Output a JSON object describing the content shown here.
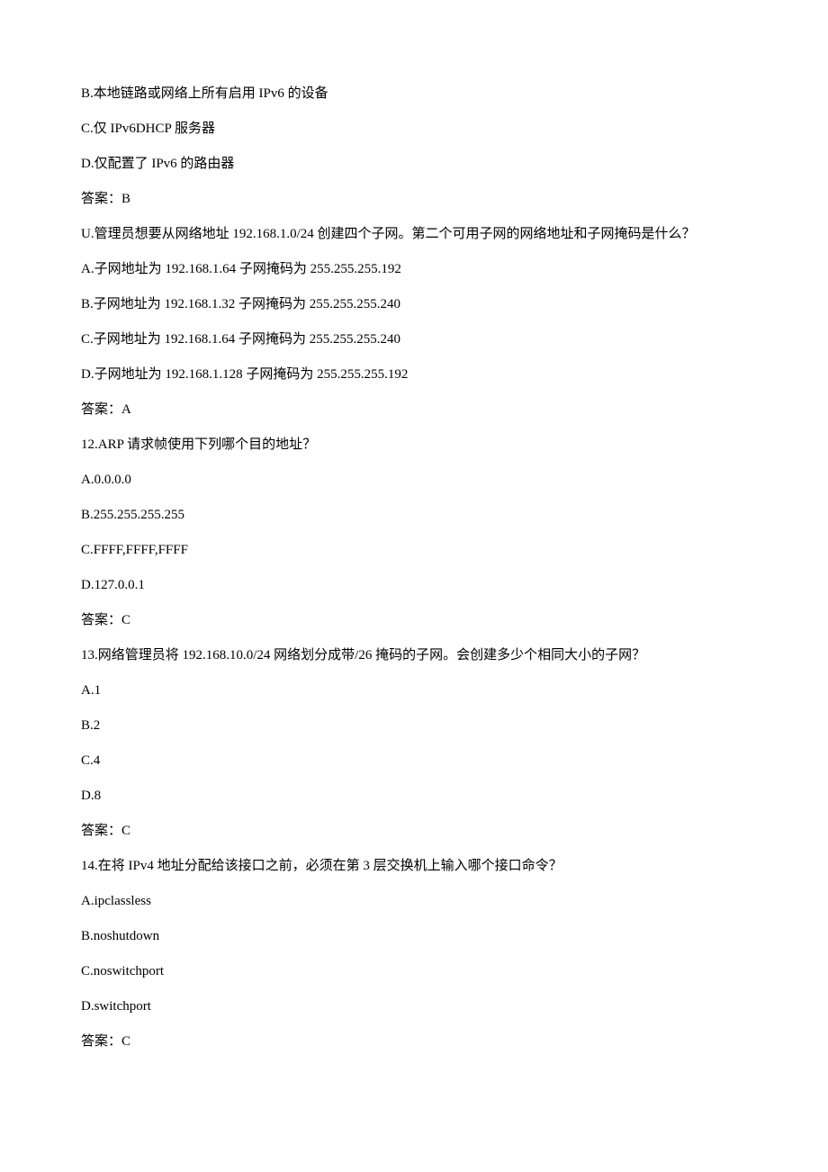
{
  "lines": [
    {
      "text": "B.本地链路或网络上所有启用 IPv6 的设备"
    },
    {
      "text": "C.仅 IPv6DHCP 服务器"
    },
    {
      "text": "D.仅配置了 IPv6 的路由器"
    },
    {
      "text": "答案：B"
    },
    {
      "text": "U.管理员想要从网络地址 192.168.1.0/24 创建四个子网。第二个可用子网的网络地址和子网掩码是什么？"
    },
    {
      "text": "A.子网地址为 192.168.1.64 子网掩码为 255.255.255.192"
    },
    {
      "text": "B.子网地址为 192.168.1.32 子网掩码为 255.255.255.240"
    },
    {
      "text": "C.子网地址为 192.168.1.64 子网掩码为 255.255.255.240"
    },
    {
      "text": "D.子网地址为 192.168.1.128 子网掩码为 255.255.255.192"
    },
    {
      "text": "答案：A"
    },
    {
      "text": "12.ARP 请求帧使用下列哪个目的地址？"
    },
    {
      "text": "A.0.0.0.0"
    },
    {
      "text": "B.255.255.255.255"
    },
    {
      "text": "C.FFFF,FFFF,FFFF"
    },
    {
      "text": "D.127.0.0.1"
    },
    {
      "text": "答案：C"
    },
    {
      "text": "13.网络管理员将 192.168.10.0/24 网络划分成带/26 掩码的子网。会创建多少个相同大小的子网？"
    },
    {
      "text": "A.1"
    },
    {
      "text": "B.2"
    },
    {
      "text": "C.4"
    },
    {
      "text": "D.8"
    },
    {
      "text": "答案：C"
    },
    {
      "text": "14.在将 IPv4 地址分配给该接口之前，必须在第 3 层交换机上输入哪个接口命令？"
    },
    {
      "text": "A.ipclassless"
    },
    {
      "text": "B.noshutdown"
    },
    {
      "text": "C.noswitchport"
    },
    {
      "text": "D.switchport"
    },
    {
      "text": "答案：C"
    }
  ]
}
